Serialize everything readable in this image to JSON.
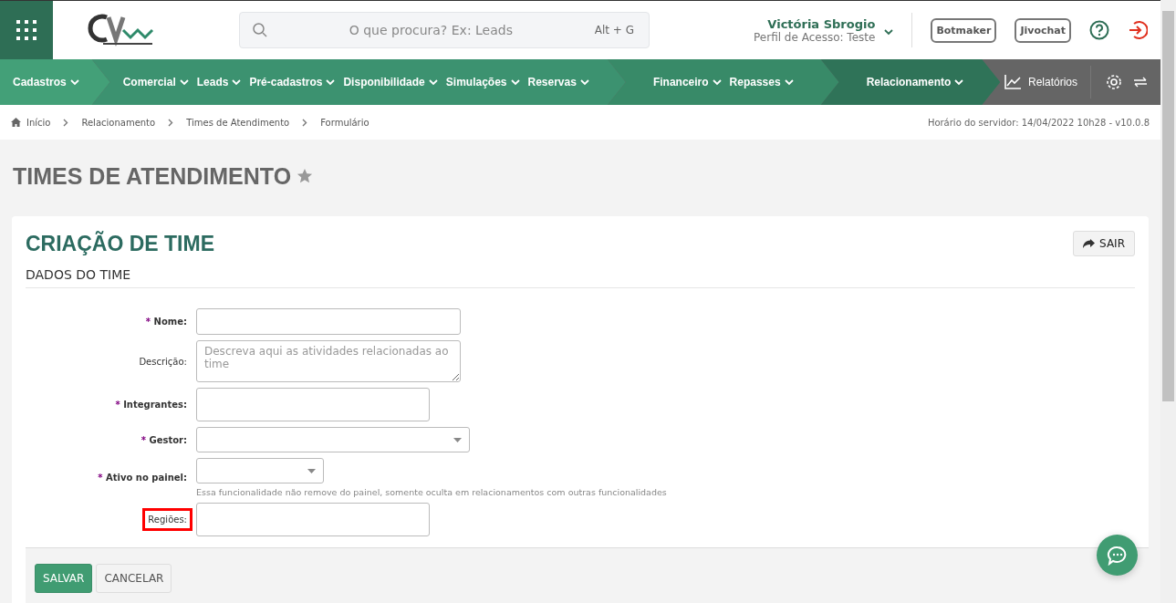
{
  "header": {
    "search": {
      "placeholder": "O que procura? Ex: Leads",
      "shortcut": "Alt + G"
    },
    "user": {
      "name": "Victória Sbrogio",
      "profile": "Perfil de Acesso: Teste"
    },
    "buttons": [
      "Botmaker",
      "Jivochat"
    ]
  },
  "nav": {
    "segments": [
      {
        "color": "#43a078",
        "items": [
          "Cadastros"
        ]
      },
      {
        "color": "#3c9270",
        "items": [
          "Comercial",
          "Leads",
          "Pré-cadastros",
          "Disponibilidade",
          "Simulações",
          "Reservas"
        ]
      },
      {
        "color": "#388a68",
        "items": [
          "Financeiro",
          "Repasses"
        ]
      },
      {
        "color": "#2f7358",
        "items": [
          "Relacionamento"
        ]
      }
    ],
    "reports": "Relatórios"
  },
  "breadcrumb": {
    "items": [
      "Início",
      "Relacionamento",
      "Times de Atendimento",
      "Formulário"
    ],
    "server_time": "Horário do servidor: 14/04/2022 10h28 - v10.0.8"
  },
  "page_title": "TIMES DE ATENDIMENTO",
  "favorite": false,
  "form": {
    "title": "CRIAÇÃO DE TIME",
    "exit_button": "SAIR",
    "section": "DADOS DO TIME",
    "fields": [
      {
        "kind": "text",
        "label": "Nome:",
        "required": true,
        "marker": "*",
        "highlighted": false
      },
      {
        "kind": "textarea",
        "label": "Descrição:",
        "required": false,
        "highlighted": false,
        "placeholder": "Descreva aqui as atividades relacionadas ao time"
      },
      {
        "kind": "multi",
        "label": "Integrantes:",
        "required": true,
        "marker": "*",
        "highlighted": false
      },
      {
        "kind": "select",
        "label": "Gestor:",
        "required": true,
        "marker": "*",
        "highlighted": false
      },
      {
        "kind": "select",
        "label": "Ativo no painel:",
        "required": true,
        "marker": "*",
        "highlighted": false,
        "help": "Essa funcionalidade não remove do painel, somente oculta em relacionamentos com outras funcionalidades"
      },
      {
        "kind": "multi",
        "label": "Regiões:",
        "required": false,
        "highlighted": true
      }
    ],
    "buttons": [
      {
        "label": "SALVAR",
        "kind": "primary"
      },
      {
        "label": "CANCELAR",
        "kind": "secondary"
      }
    ]
  }
}
